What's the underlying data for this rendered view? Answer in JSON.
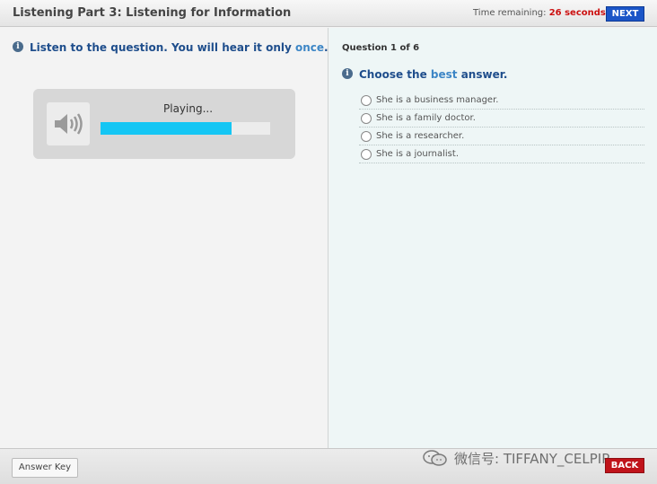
{
  "header": {
    "title": "Listening Part 3: Listening for Information",
    "time_label": "Time remaining:",
    "time_value": "26 seconds",
    "next_label": "NEXT"
  },
  "left": {
    "instruction_before": "Listen to the question. You will hear it only ",
    "instruction_highlight": "once",
    "instruction_after": ".",
    "player": {
      "status": "Playing...",
      "progress_fraction": 0.77,
      "icon": "speaker-icon"
    }
  },
  "right": {
    "question_number": "Question 1 of 6",
    "prompt_before": "Choose the ",
    "prompt_highlight": "best",
    "prompt_after": " answer.",
    "options": [
      "She is a business manager.",
      "She is a family doctor.",
      "She is a researcher.",
      "She is a journalist."
    ]
  },
  "footer": {
    "answer_key_label": "Answer Key",
    "watermark": "微信号: TIFFANY_CELPIP",
    "back_label": "BACK"
  },
  "colors": {
    "accent_blue": "#1b55c7",
    "heading_blue": "#1f4e8c",
    "highlight_blue": "#3d86c6",
    "timer_red": "#cc1111",
    "progress_cyan": "#14c6f4",
    "back_red": "#c0131a"
  }
}
